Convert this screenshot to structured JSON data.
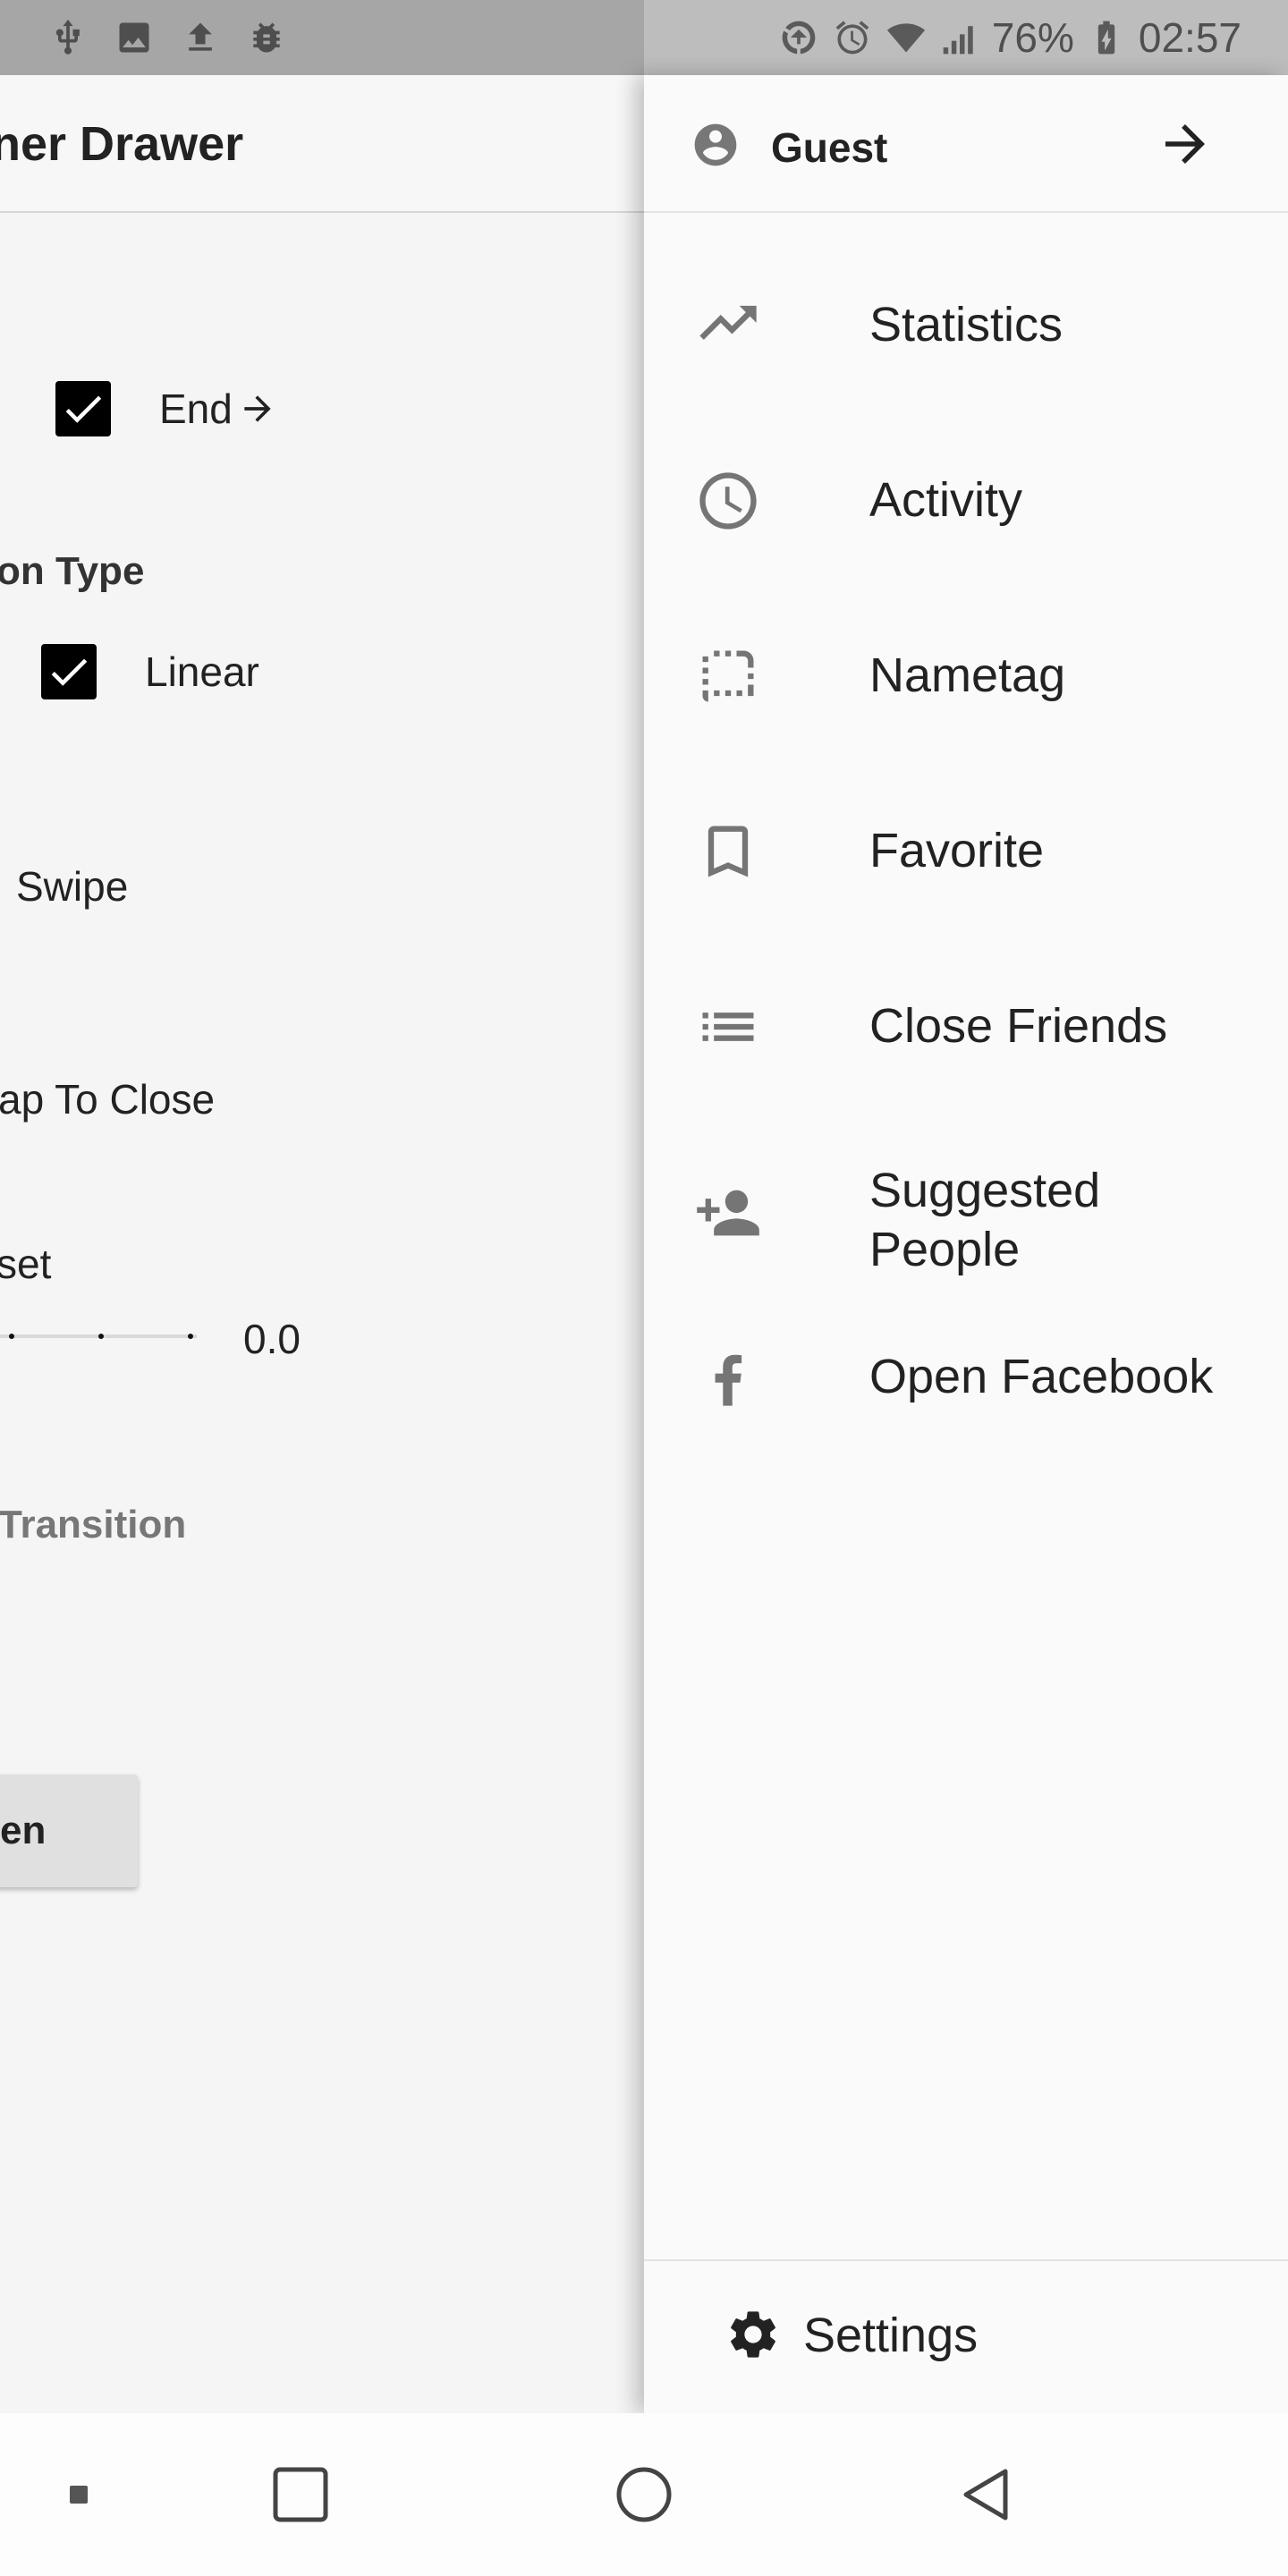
{
  "status_bar": {
    "left_icons": [
      "usb-icon",
      "image-icon",
      "upload-icon",
      "bug-icon"
    ],
    "right_icons": [
      "data-saver-icon",
      "alarm-icon",
      "wifi-icon",
      "signal-icon",
      "battery-charging-icon"
    ],
    "battery_percent": "76%",
    "time": "02:57"
  },
  "main": {
    "title": "ner Drawer",
    "end_checkbox": {
      "label": "End",
      "checked": true
    },
    "animation_type_heading": "on Type",
    "linear_checkbox": {
      "label": "Linear",
      "checked": true
    },
    "swipe_label": "Swipe",
    "tap_to_close_label": "ap To Close",
    "offset_label": "set",
    "offset_value": "0.0",
    "transition_label": "Transition",
    "open_button_label": "en"
  },
  "drawer": {
    "header": {
      "user_name": "Guest"
    },
    "items": [
      {
        "label": "Statistics",
        "icon": "trending-up-icon"
      },
      {
        "label": "Activity",
        "icon": "clock-icon"
      },
      {
        "label": "Nametag",
        "icon": "crop-free-icon"
      },
      {
        "label": "Favorite",
        "icon": "bookmark-icon"
      },
      {
        "label": "Close Friends",
        "icon": "list-icon"
      },
      {
        "label": "Suggested People",
        "icon": "person-add-icon"
      },
      {
        "label": "Open Facebook",
        "icon": "facebook-icon"
      }
    ],
    "footer": {
      "settings_label": "Settings"
    }
  },
  "nav_bar": {
    "buttons": [
      "menu-dot-button",
      "recents-button",
      "home-button",
      "back-button"
    ]
  },
  "colors": {
    "status_bar_left": "#a6a6a6",
    "status_bar_right": "#bdbdbd",
    "drawer_bg": "#fafafa",
    "icon_gray": "#757575",
    "text_dark": "#222222"
  }
}
